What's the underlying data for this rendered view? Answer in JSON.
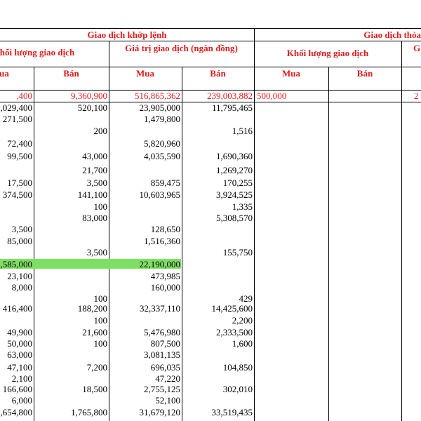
{
  "header": {
    "group1": "Giao dịch khớp lệnh",
    "group2": "Giao dịch thỏa t",
    "g1_volume": "hối lượng giao dịch",
    "g1_value": "Giá trị giao dịch (ngàn đồng)",
    "g2_volume": "Khối lượng giao dịch",
    "g2_next": "G",
    "c_mua1": "ua",
    "c_ban1": "Bán",
    "c_mua2": "Mua",
    "c_ban2": "Bán",
    "c_mua3": "Mua",
    "c_ban3": "Bán"
  },
  "totals": ",400|9,360,900|516,865,362|239,003,882|500,000|2",
  "rows": [
    ",029,400|520,100|23,905,000|11,795,465",
    "271,500||1,479,800|",
    "|200||1,516",
    "72,400||5,820,960|",
    "99,500|43,000|4,035,590|1,690,360",
    "|21,700||1,269,270",
    "17,500|3,500|859,475|170,255",
    "374,500|141,100|10,603,965|3,924,525",
    "|100||1,335",
    "|83,000||5,308,570",
    "3,500||128,650|",
    "85,000||1,516,360|",
    "|3,500||155,750",
    ",585,000||22,190,000|",
    "23,100||473,985|",
    "8,000||160,000|",
    "|100||429",
    "416,400|188,200|32,337,110|14,425,600",
    "|100||2,200",
    "49,900|21,600|5,476,980|2,333,500",
    "50,000|100|807,500|1,600",
    "63,000||3,081,135|",
    "47,100|7,200|696,035|104,850",
    "2,100||47,220|",
    "166,600|18,500|2,755,125|302,010",
    "6,000||52,100|",
    ",654,800|1,765,800|31,679,120|33,519,435"
  ]
}
